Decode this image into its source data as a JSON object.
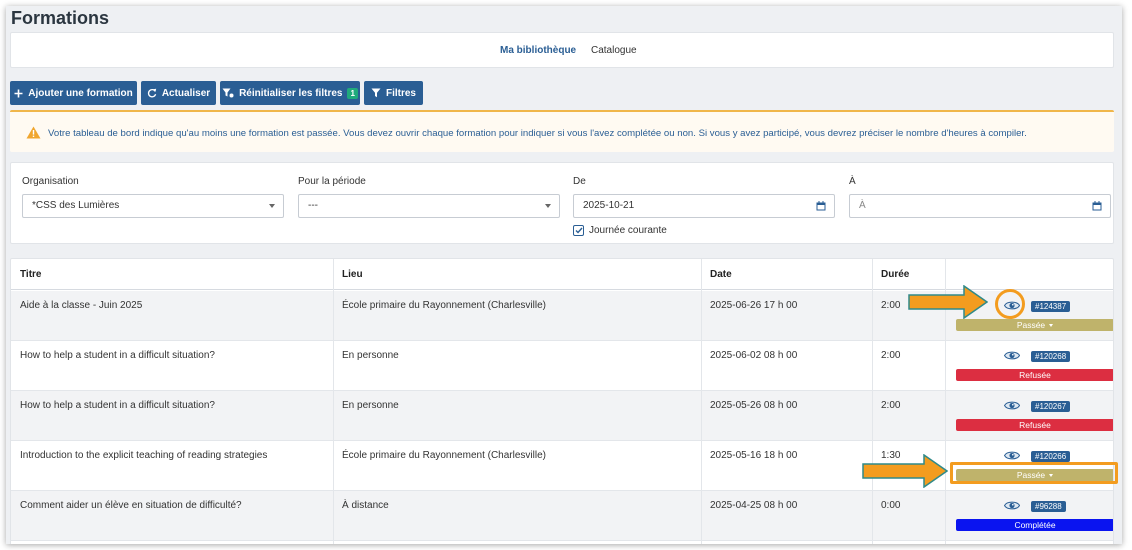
{
  "page": {
    "title": "Formations"
  },
  "nav": {
    "tabs": [
      "Ma bibliothèque",
      "Catalogue"
    ]
  },
  "toolbar": {
    "add": "Ajouter une formation",
    "refresh": "Actualiser",
    "reset": "Réinitialiser les filtres",
    "reset_count": "1",
    "filters": "Filtres"
  },
  "alert": {
    "text": "Votre tableau de bord indique qu'au moins une formation est passée. Vous devez ouvrir chaque formation pour indiquer si vous l'avez complétée ou non. Si vous y avez participé, vous devrez préciser le nombre d'heures à compiler."
  },
  "filters": {
    "org_label": "Organisation",
    "org_value": "*CSS des Lumières",
    "period_label": "Pour la période",
    "period_value": "---",
    "from_label": "De",
    "from_value": "2025-10-21",
    "to_label": "À",
    "to_placeholder": "À",
    "today_label": "Journée courante"
  },
  "table": {
    "headers": [
      "Titre",
      "Lieu",
      "Date",
      "Durée"
    ],
    "rows": [
      {
        "title": "Aide à la classe - Juin 2025",
        "location": "École primaire du Rayonnement (Charlesville)",
        "date": "2025-06-26 17 h 00",
        "duration": "2:00",
        "id": "#124387",
        "status": "Passée",
        "dropdown": true
      },
      {
        "title": "How to help a student in a difficult situation?",
        "location": "En personne",
        "date": "2025-06-02 08 h 00",
        "duration": "2:00",
        "id": "#120268",
        "status": "Refusée",
        "dropdown": false
      },
      {
        "title": "How to help a student in a difficult situation?",
        "location": "En personne",
        "date": "2025-05-26 08 h 00",
        "duration": "2:00",
        "id": "#120267",
        "status": "Refusée",
        "dropdown": false
      },
      {
        "title": "Introduction to the explicit teaching of reading strategies",
        "location": "École primaire du Rayonnement (Charlesville)",
        "date": "2025-05-16 18 h 00",
        "duration": "1:30",
        "id": "#120266",
        "status": "Passée",
        "dropdown": true
      },
      {
        "title": "Comment aider un élève en situation de difficulté?",
        "location": "À distance",
        "date": "2025-04-25 08 h 00",
        "duration": "0:00",
        "id": "#96288",
        "status": "Complétée",
        "dropdown": false
      }
    ]
  },
  "colors": {
    "primary": "#2a5e94",
    "passee": "#bfb36b",
    "refusee": "#dc2e41",
    "completee": "#0a14f0",
    "highlight": "#f39c1f",
    "arrow_stroke": "#2f8a8a"
  }
}
